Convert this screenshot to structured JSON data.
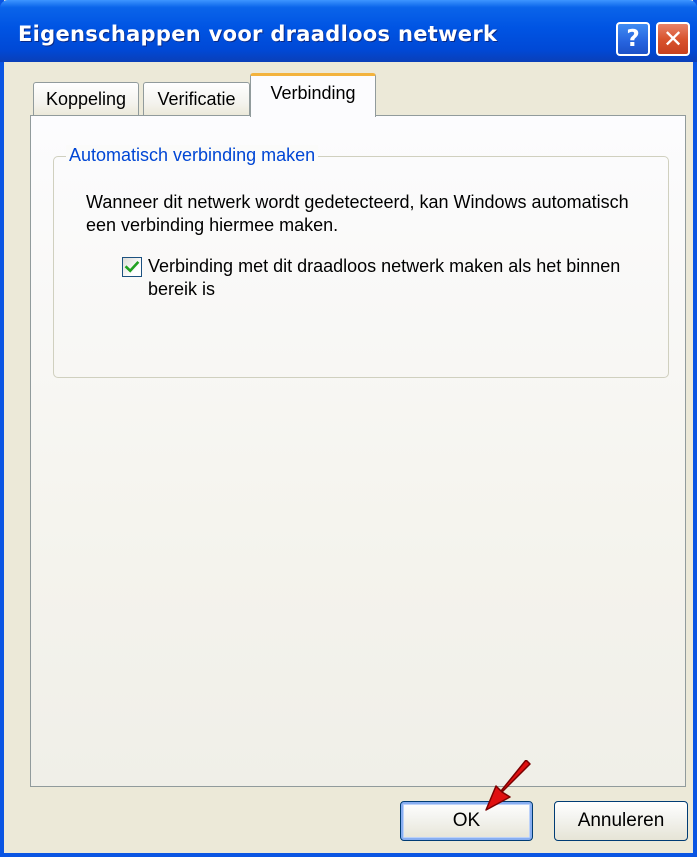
{
  "window": {
    "title": "Eigenschappen voor draadloos netwerk",
    "help_label": "?",
    "close_label": "✕"
  },
  "tabs": [
    {
      "label": "Koppeling",
      "active": false
    },
    {
      "label": "Verificatie",
      "active": false
    },
    {
      "label": "Verbinding",
      "active": true
    }
  ],
  "panel": {
    "group_title": "Automatisch verbinding maken",
    "description": "Wanneer dit netwerk wordt gedetecteerd, kan Windows automatisch een verbinding hiermee maken.",
    "checkbox": {
      "label": "Verbinding met dit draadloos netwerk maken als het binnen bereik is",
      "checked": true
    }
  },
  "buttons": {
    "ok_label": "OK",
    "cancel_label": "Annuleren"
  },
  "colors": {
    "titlebar": "#0054e3",
    "group_title": "#0046d5",
    "active_tab_accent": "#f3b33d",
    "checkmark": "#21a121",
    "pointer_arrow": "#e01010"
  },
  "icons": {
    "help": "question-mark",
    "close": "x-mark",
    "check": "checkmark",
    "pointer": "red-arrow"
  }
}
